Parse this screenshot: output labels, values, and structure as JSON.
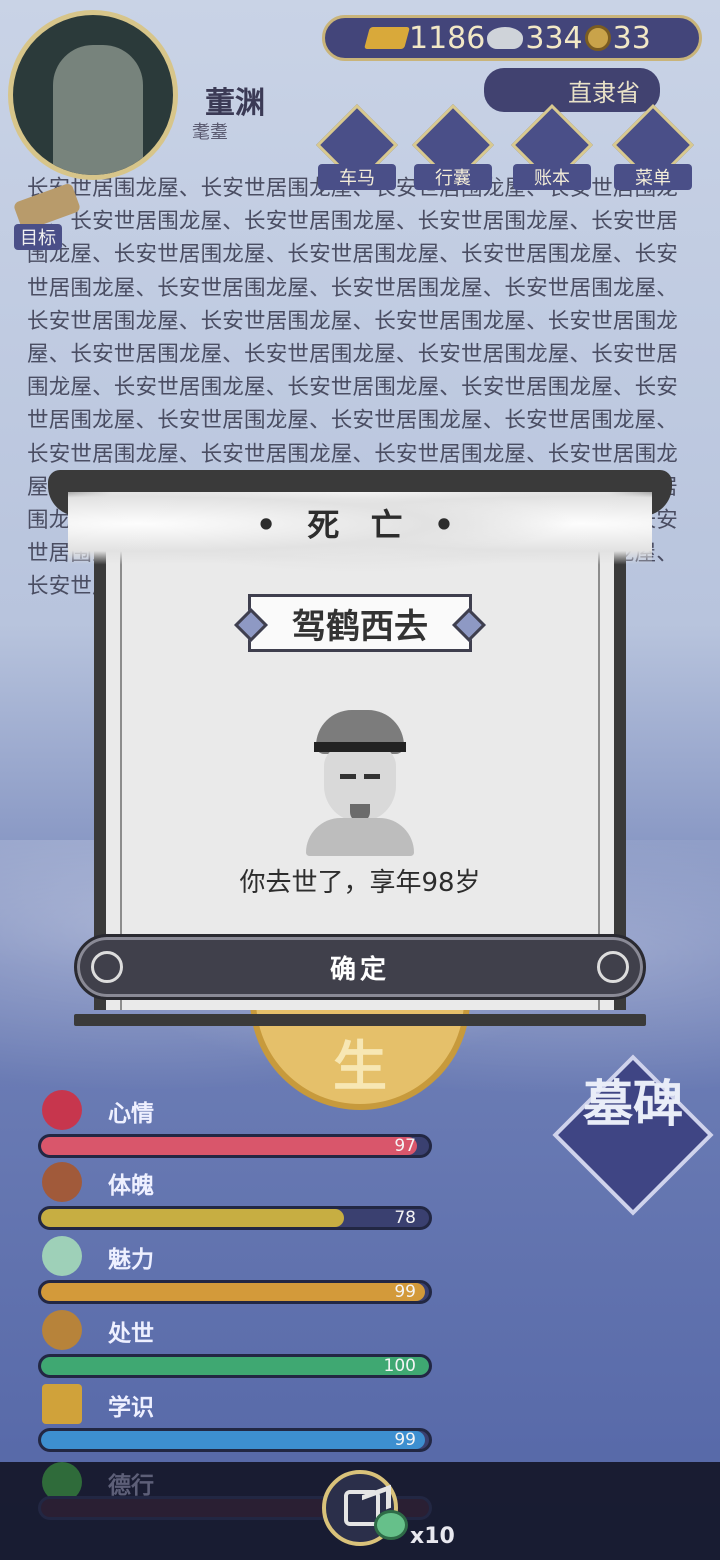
{
  "player": {
    "name": "董渊",
    "title": "耄耋",
    "region": "直隶省"
  },
  "currency": {
    "gold": "1186",
    "silver": "334",
    "coin": "33"
  },
  "nav": [
    {
      "label": "车马",
      "icon": "carriage-icon"
    },
    {
      "label": "行囊",
      "icon": "bag-icon"
    },
    {
      "label": "账本",
      "icon": "ledger-icon"
    },
    {
      "label": "菜单",
      "icon": "menu-icon"
    }
  ],
  "goal_label": "目标",
  "background_text": "长安世居围龙屋、长安世居围龙屋、长安世居围龙屋、长安世居围龙屋、长安世居围龙屋、长安世居围龙屋、长安世居围龙屋、长安世居围龙屋、长安世居围龙屋、长安世居围龙屋、长安世居围龙屋、长安世居围龙屋、长安世居围龙屋、长安世居围龙屋、长安世居围龙屋、长安世居围龙屋、长安世居围龙屋、长安世居围龙屋、长安世居围龙屋、长安世居围龙屋、长安世居围龙屋、长安世居围龙屋、长安世居围龙屋、长安世居围龙屋、长安世居围龙屋、长安世居围龙屋、长安世居围龙屋、长安世居围龙屋、长安世居围龙屋、长安世居围龙屋、长安世居围龙屋、长安世居围龙屋、长安世居围龙屋、长安世居围龙屋、长安世居围龙屋、长安世居围龙屋、长安世居围龙屋、长安世居围龙屋、长安世居围龙屋、长安世居围龙屋、长安世居围龙屋、长安世居围龙屋、长安世居围龙屋、长安世居围龙屋、长安世居围龙屋、长安世居土楼屋舍",
  "stats": [
    {
      "label": "心情",
      "value": 97,
      "color": "#d9566b",
      "icon": "flower-icon"
    },
    {
      "label": "体魄",
      "value": 78,
      "color": "#c7ae42",
      "icon": "strength-icon"
    },
    {
      "label": "魅力",
      "value": 99,
      "color": "#d39a3a",
      "icon": "mirror-icon"
    },
    {
      "label": "处世",
      "value": 100,
      "color": "#3fa872",
      "icon": "tea-icon"
    },
    {
      "label": "学识",
      "value": 99,
      "color": "#3d8fd0",
      "icon": "books-icon"
    },
    {
      "label": "德行",
      "value": 0,
      "color": "#6b3b6e",
      "icon": "virtue-icon"
    }
  ],
  "tombstone_label": "墓碑",
  "seal_char": "生",
  "share_multiplier": "x10",
  "dialog": {
    "heading": "• 死 亡 •",
    "plaque": "驾鹤西去",
    "message": "你去世了，享年98岁",
    "confirm": "确定"
  }
}
